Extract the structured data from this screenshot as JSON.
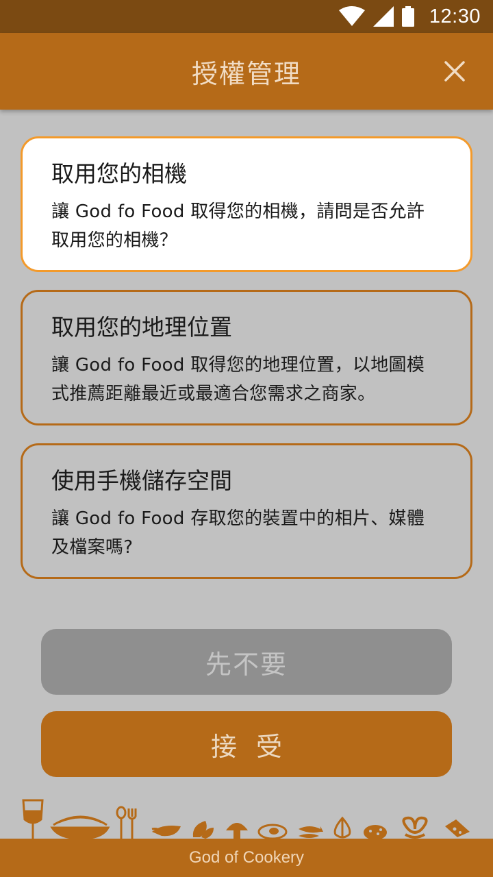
{
  "status_bar": {
    "time": "12:30",
    "icons": [
      "wifi-icon",
      "cellular-signal-icon",
      "battery-icon"
    ]
  },
  "header": {
    "title": "授權管理",
    "close_icon": "close-icon"
  },
  "permissions": [
    {
      "title": "取用您的相機",
      "description_line1": "讓 God fo Food 取得您的相機，請問是否允許",
      "description_line2": "取用您的相機？",
      "selected": true
    },
    {
      "title": "取用您的地理位置",
      "description_line1": "讓 God fo Food 取得您的地理位置，以地圖模",
      "description_line2": "式推薦距離最近或最適合您需求之商家。",
      "selected": false
    },
    {
      "title": "使用手機儲存空間",
      "description_line1": "讓 God fo Food 存取您的裝置中的相片、媒體",
      "description_line2": "及檔案嗎?",
      "selected": false
    }
  ],
  "buttons": {
    "decline": "先不要",
    "accept": "接受"
  },
  "footer": {
    "brand": "God of Cookery"
  },
  "colors": {
    "primary": "#b56a18",
    "status_bar": "#7b4a12",
    "highlight_border": "#f39a2b",
    "background": "#c1c1c1"
  },
  "decoration_icons": [
    "wine-glass-icon",
    "noodle-bowl-icon",
    "spoon-fork-icon",
    "vegetable-icon",
    "leaf-icon",
    "mushroom-icon",
    "fried-egg-icon",
    "fish-icon",
    "onion-icon",
    "cookie-icon",
    "pretzel-icon",
    "cheese-icon"
  ]
}
